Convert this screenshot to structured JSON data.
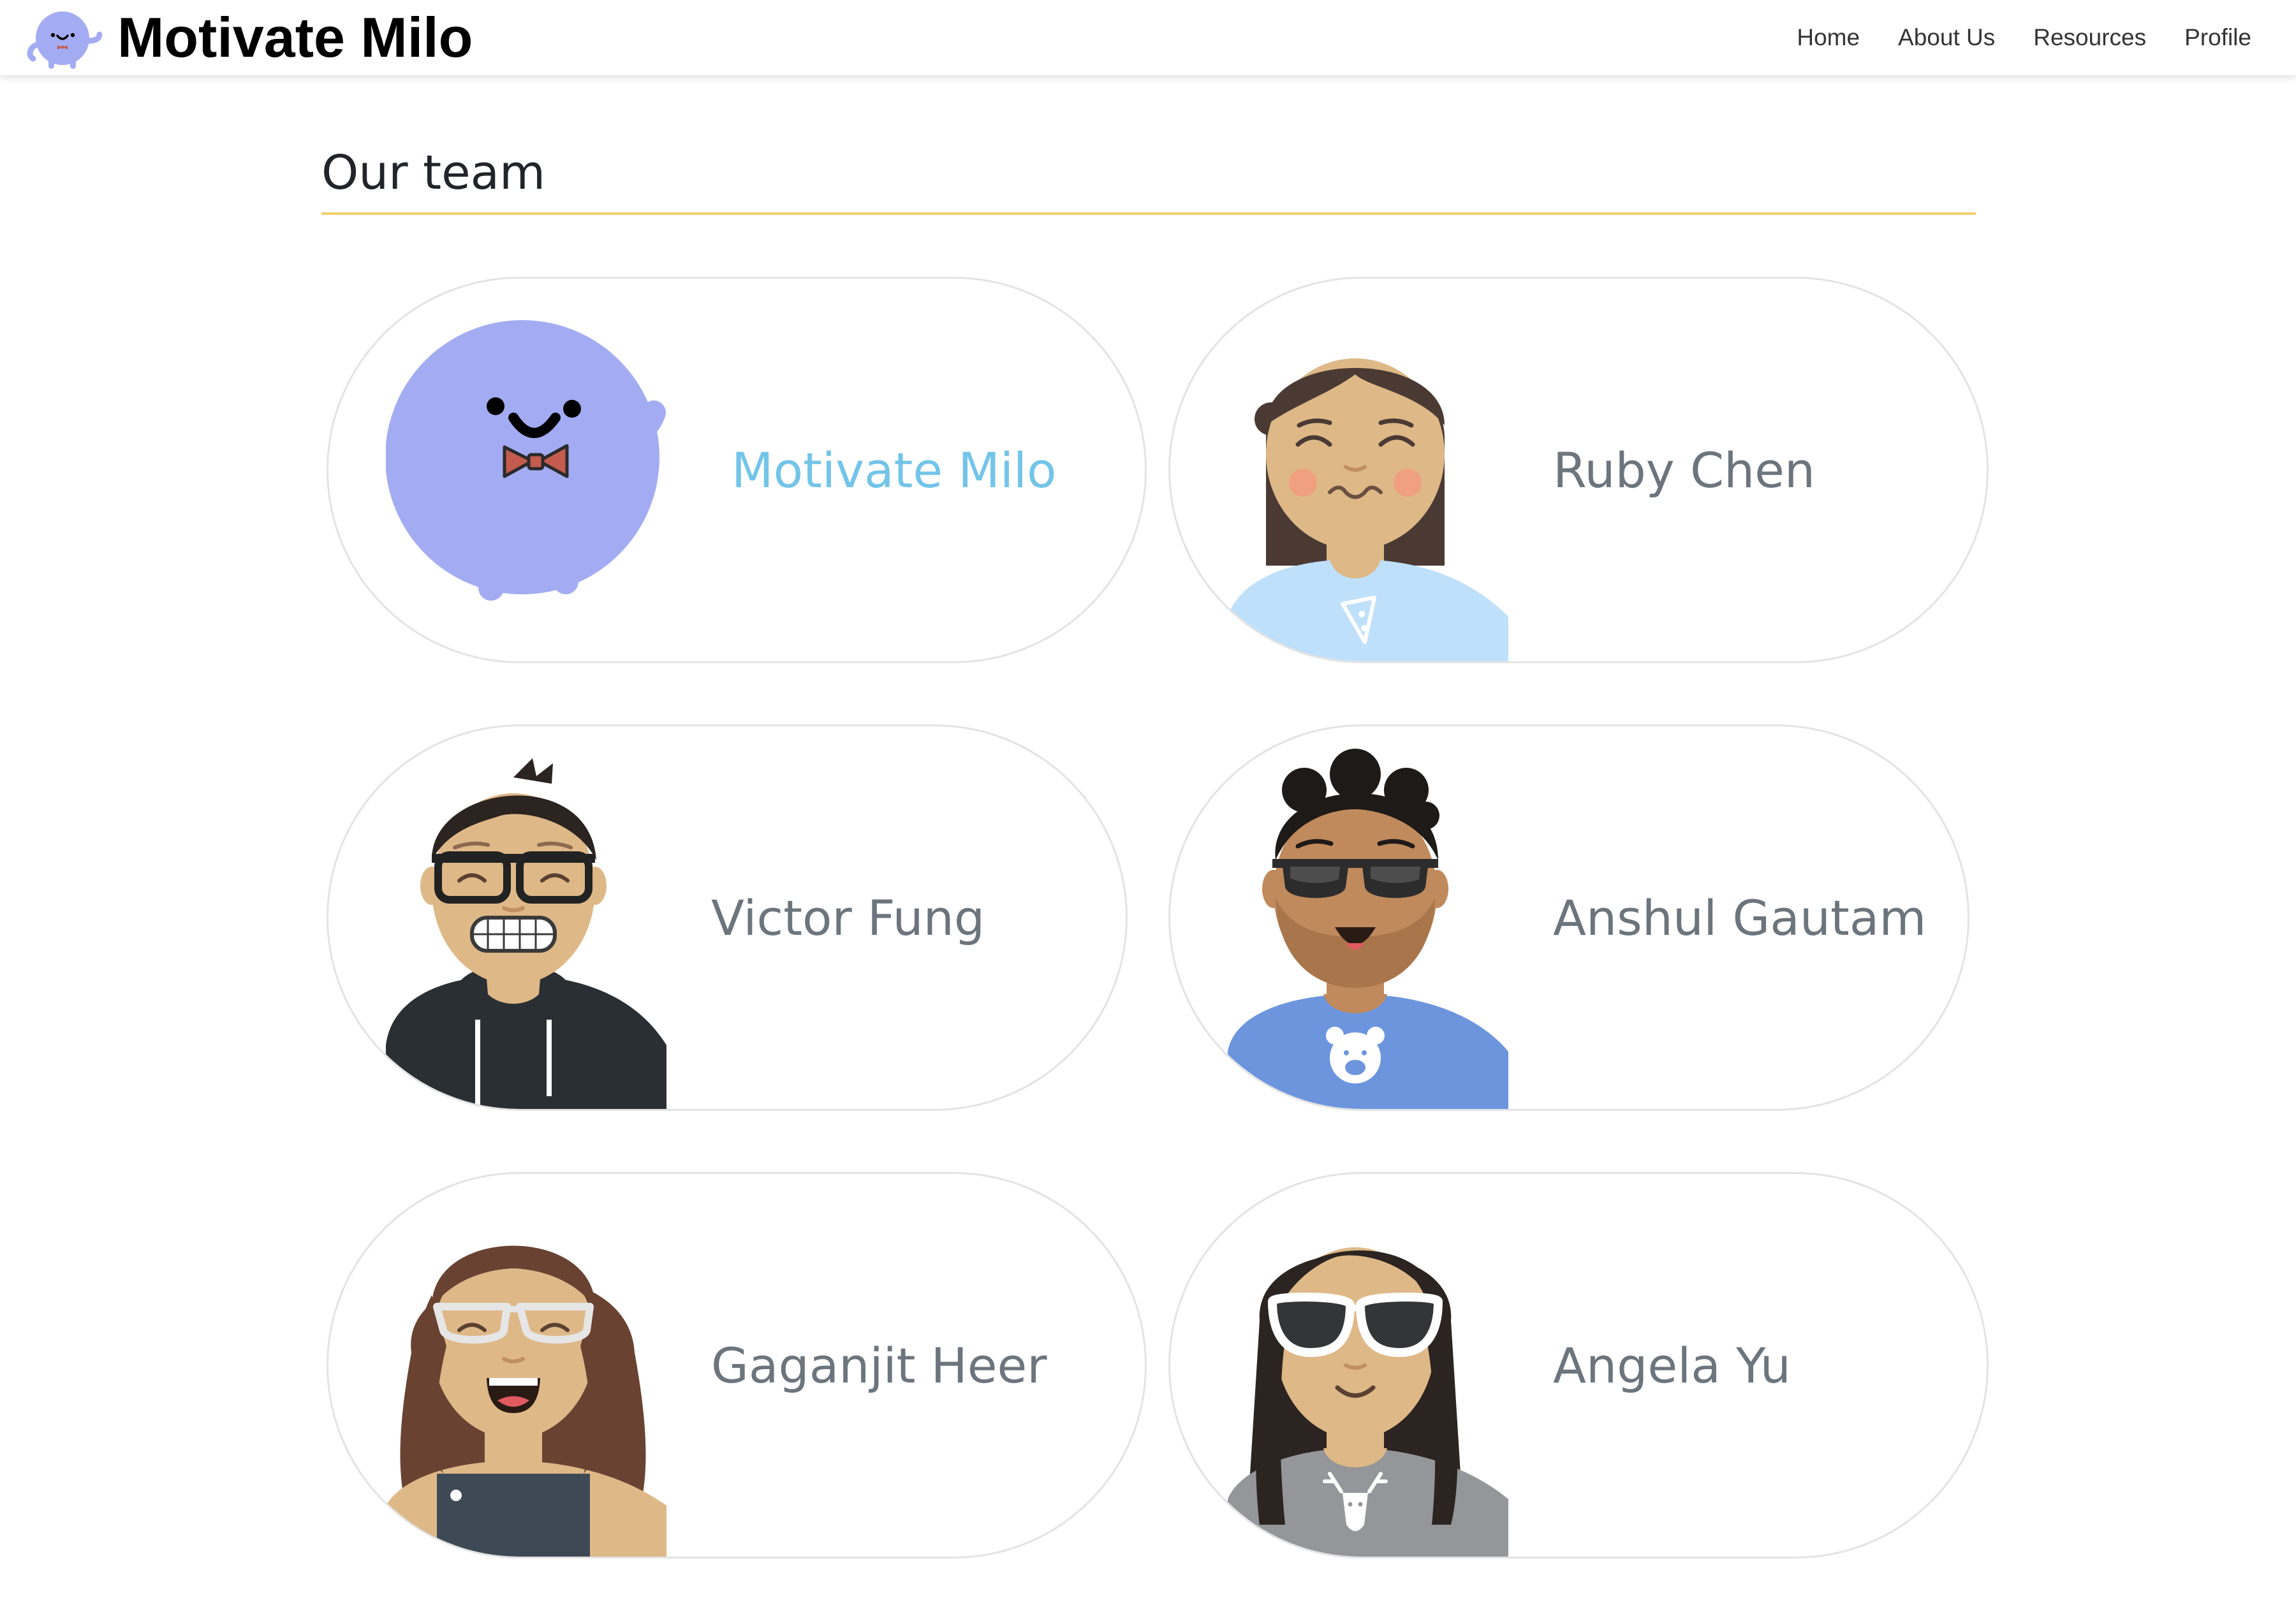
{
  "navbar": {
    "brand_title": "Motivate Milo",
    "links": [
      "Home",
      "About Us",
      "Resources",
      "Profile"
    ]
  },
  "main": {
    "section_title": "Our team",
    "members": [
      {
        "name": "Motivate Milo",
        "avatar": "milo-mascot-avatar"
      },
      {
        "name": "Ruby Chen",
        "avatar": "woman-pizza-shirt-avatar"
      },
      {
        "name": "Victor Fung",
        "avatar": "man-glasses-hoodie-avatar"
      },
      {
        "name": "Anshul Gautam",
        "avatar": "man-sunglasses-bear-shirt-avatar"
      },
      {
        "name": "Gaganjit Heer",
        "avatar": "woman-curly-hair-glasses-avatar"
      },
      {
        "name": "Angela Yu",
        "avatar": "woman-sunglasses-deer-shirt-avatar"
      }
    ]
  },
  "colors": {
    "milo_purple": "#a3acf2",
    "accent_yellow": "#f5cf6f",
    "milo_name_blue": "#73c4e9",
    "name_gray": "#6c757d"
  }
}
